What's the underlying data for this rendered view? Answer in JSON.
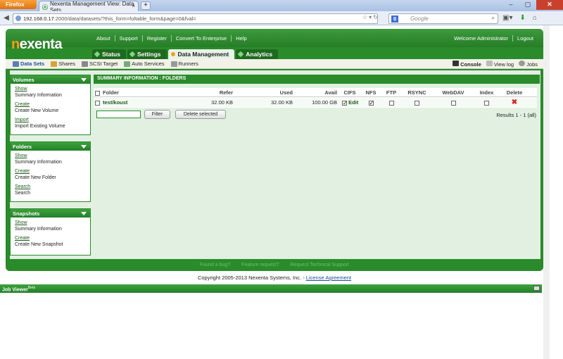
{
  "browser": {
    "app_button": "Firefox",
    "tab_title": "Nexenta Management View: Data Sets",
    "url_host": "192.168.0.17",
    "url_rest": ":2000/data/datasets/?this_form=foltable_form&page=0&fval=",
    "search_placeholder": "Google"
  },
  "app": {
    "logo_prefix": "n",
    "logo_rest": "exenta",
    "top_links": [
      "About",
      "Support",
      "Register",
      "Convert To Enterprise",
      "Help"
    ],
    "welcome": "Welcome Administrator",
    "logout": "Logout",
    "main_tabs": [
      "Status",
      "Settings",
      "Data Management",
      "Analytics"
    ],
    "active_tab": "Data Management",
    "sub_nav": [
      "Data Sets",
      "Shares",
      "SCSI Target",
      "Auto Services",
      "Runners"
    ],
    "sub_right": [
      "Console",
      "View log",
      "Jobs"
    ]
  },
  "sidebar": {
    "volumes": {
      "title": "Volumes",
      "items": [
        {
          "link": "Show",
          "desc": "Summary Information"
        },
        {
          "link": "Create",
          "desc": "Create New Volume"
        },
        {
          "link": "Import",
          "desc": "Import Existing Volume"
        }
      ]
    },
    "folders": {
      "title": "Folders",
      "items": [
        {
          "link": "Show",
          "desc": "Summary Information"
        },
        {
          "link": "Create",
          "desc": "Create New Folder"
        },
        {
          "link": "Search",
          "desc": "Search"
        }
      ]
    },
    "snapshots": {
      "title": "Snapshots",
      "items": [
        {
          "link": "Show",
          "desc": "Summary Information"
        },
        {
          "link": "Create",
          "desc": "Create New Snapshot"
        }
      ]
    }
  },
  "main": {
    "summary_title": "SUMMARY INFORMATION : FOLDERS",
    "columns": [
      "Folder",
      "Refer",
      "Used",
      "Avail",
      "CIFS",
      "NFS",
      "FTP",
      "RSYNC",
      "WebDAV",
      "Index",
      "Delete"
    ],
    "rows": [
      {
        "folder": "test/koust",
        "refer": "32.00 KB",
        "used": "32.00 KB",
        "avail": "100.00 GB",
        "cifs_action": "Edit"
      }
    ],
    "filter_button": "Filter",
    "delete_selected_button": "Delete selected",
    "results": "Results 1 - 1 (all)"
  },
  "footer": {
    "links": [
      "Found a bug?",
      "Feature request?",
      "Request Technical Support"
    ],
    "copyright": "Copyright 2005-2013 Nexenta Systems, Inc. - ",
    "license_link": "License Agreement"
  },
  "job_viewer": {
    "title": "Job Viewer",
    "badge": "Beta"
  }
}
